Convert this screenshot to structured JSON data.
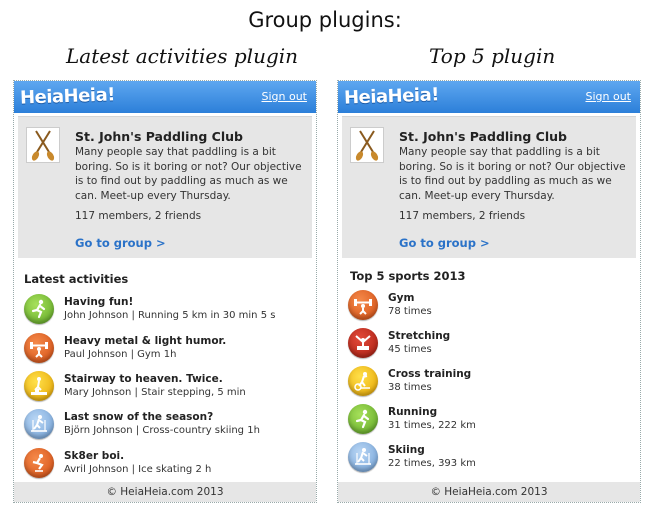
{
  "page": {
    "title": "Group plugins:",
    "left_label": "Latest activities plugin",
    "right_label": "Top 5 plugin"
  },
  "widget": {
    "logo": "HeiaHeia!",
    "signout": "Sign out",
    "footer": "© HeiaHeia.com 2013"
  },
  "group": {
    "name": "St. John's Paddling Club",
    "description": "Many people say that paddling is a bit boring. So is it boring or not? Our objective is to find out by paddling as much as we can. Meet-up every Thursday.",
    "members": "117 members, 2 friends",
    "link": "Go to group >"
  },
  "latest": {
    "title": "Latest activities",
    "items": [
      {
        "title": "Having fun!",
        "sub": "John Johnson | Running 5 km in 30 min 5 s",
        "icon": "running-icon",
        "color": "green"
      },
      {
        "title": "Heavy metal & light humor.",
        "sub": "Paul Johnson | Gym 1h",
        "icon": "gym-icon",
        "color": "orange"
      },
      {
        "title": "Stairway to heaven. Twice.",
        "sub": "Mary Johnson | Stair stepping, 5 min",
        "icon": "stair-stepping-icon",
        "color": "yellow"
      },
      {
        "title": "Last snow of the season?",
        "sub": "Björn Johnson | Cross-country skiing 1h",
        "icon": "skiing-icon",
        "color": "blue"
      },
      {
        "title": "Sk8er boi.",
        "sub": "Avril Johnson | Ice skating 2 h",
        "icon": "ice-skating-icon",
        "color": "orange"
      }
    ]
  },
  "top5": {
    "title": "Top 5 sports 2013",
    "items": [
      {
        "title": "Gym",
        "sub": "78 times",
        "icon": "gym-icon",
        "color": "orange"
      },
      {
        "title": "Stretching",
        "sub": "45 times",
        "icon": "stretching-icon",
        "color": "red"
      },
      {
        "title": "Cross training",
        "sub": "38 times",
        "icon": "cross-training-icon",
        "color": "yellow"
      },
      {
        "title": "Running",
        "sub": "31 times, 222 km",
        "icon": "running-icon",
        "color": "green"
      },
      {
        "title": "Skiing",
        "sub": "22 times, 393 km",
        "icon": "skiing-icon",
        "color": "blue"
      }
    ]
  }
}
